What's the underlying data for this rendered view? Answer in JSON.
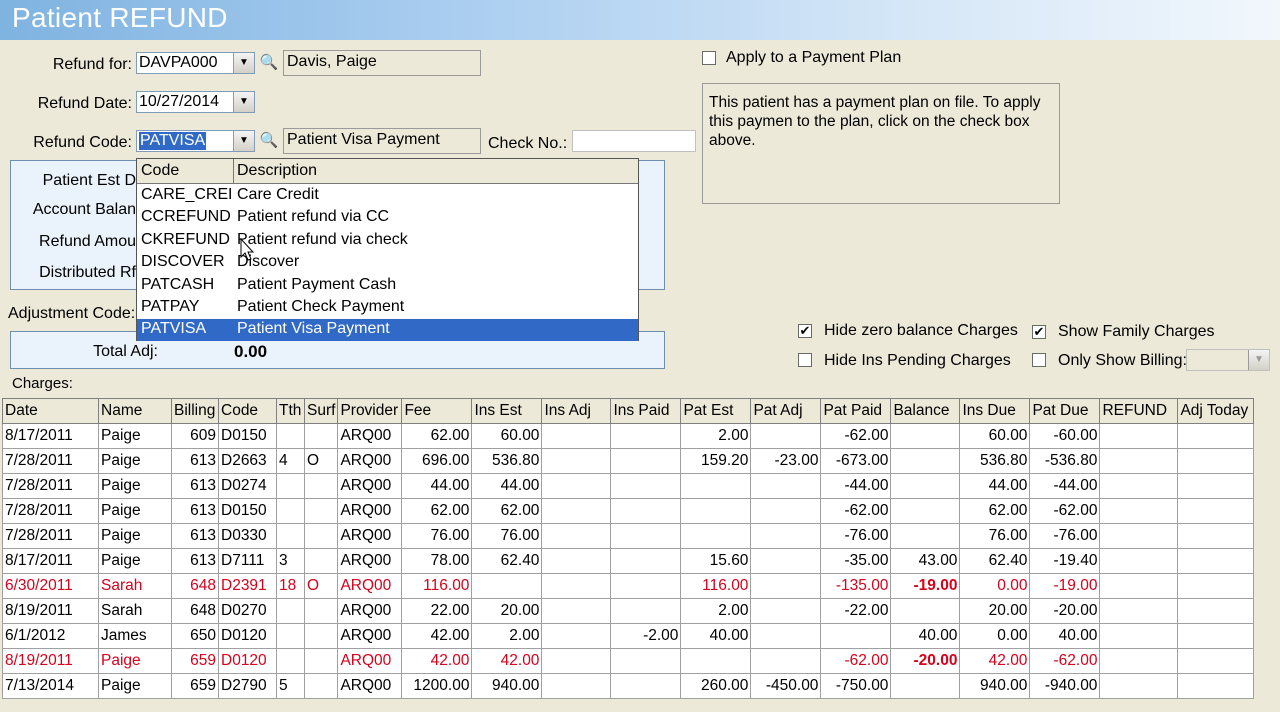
{
  "window": {
    "title": "Patient REFUND"
  },
  "form": {
    "refund_for_label": "Refund for:",
    "refund_for_value": "DAVPA000",
    "patient_name": "Davis, Paige",
    "refund_date_label": "Refund Date:",
    "refund_date_value": "10/27/2014",
    "refund_code_label": "Refund Code:",
    "refund_code_value": "PATVISA",
    "refund_code_desc": "Patient Visa Payment",
    "check_no_label": "Check No.:",
    "check_no_value": ""
  },
  "summary": {
    "patient_est_label": "Patient Est D",
    "account_balance_label": "Account Balan",
    "refund_amount_label": "Refund Amou",
    "distributed_label": "Distributed Rf"
  },
  "adjustment": {
    "code_label": "Adjustment Code:",
    "total_label": "Total Adj:",
    "total_value": "0.00"
  },
  "payment_plan": {
    "label": "Apply to a Payment Plan",
    "checked": false,
    "note": "This patient has a payment plan on file.  To apply this paymen to the plan, click on the check box above."
  },
  "filters": {
    "hide_zero": {
      "label": "Hide zero balance Charges",
      "checked": true
    },
    "show_family": {
      "label": "Show Family Charges",
      "checked": true
    },
    "hide_ins_pending": {
      "label": "Hide Ins Pending Charges",
      "checked": false
    },
    "only_billing": {
      "label": "Only Show Billing:",
      "checked": false,
      "value": ""
    }
  },
  "dropdown": {
    "headers": [
      "Code",
      "Description"
    ],
    "items": [
      {
        "code": "CARE_CREDIT",
        "desc": "Care Credit"
      },
      {
        "code": "CCREFUND",
        "desc": "Patient refund via CC"
      },
      {
        "code": "CKREFUND",
        "desc": "Patient refund via check"
      },
      {
        "code": "DISCOVER",
        "desc": "Discover"
      },
      {
        "code": "PATCASH",
        "desc": "Patient Payment Cash"
      },
      {
        "code": "PATPAY",
        "desc": "Patient Check Payment"
      },
      {
        "code": "PATVISA",
        "desc": "Patient Visa Payment"
      }
    ],
    "selected_index": 6
  },
  "charges": {
    "label": "Charges:",
    "columns": [
      "Date",
      "Name",
      "Billing",
      "Code",
      "Tth",
      "Surf",
      "Provider",
      "Fee",
      "Ins Est",
      "Ins Adj",
      "Ins Paid",
      "Pat Est",
      "Pat Adj",
      "Pat Paid",
      "Balance",
      "Ins Due",
      "Pat Due",
      "REFUND",
      "Adj Today"
    ],
    "rows": [
      {
        "red": false,
        "bold": [],
        "cells": [
          "8/17/2011",
          "Paige",
          "609",
          "D0150",
          "",
          "",
          "ARQ00",
          "62.00",
          "60.00",
          "",
          "",
          "2.00",
          "",
          "-62.00",
          "",
          "60.00",
          "-60.00",
          "",
          ""
        ]
      },
      {
        "red": false,
        "bold": [],
        "cells": [
          "7/28/2011",
          "Paige",
          "613",
          "D2663",
          "4",
          "O",
          "ARQ00",
          "696.00",
          "536.80",
          "",
          "",
          "159.20",
          "-23.00",
          "-673.00",
          "",
          "536.80",
          "-536.80",
          "",
          ""
        ]
      },
      {
        "red": false,
        "bold": [],
        "cells": [
          "7/28/2011",
          "Paige",
          "613",
          "D0274",
          "",
          "",
          "ARQ00",
          "44.00",
          "44.00",
          "",
          "",
          "",
          "",
          "-44.00",
          "",
          "44.00",
          "-44.00",
          "",
          ""
        ]
      },
      {
        "red": false,
        "bold": [],
        "cells": [
          "7/28/2011",
          "Paige",
          "613",
          "D0150",
          "",
          "",
          "ARQ00",
          "62.00",
          "62.00",
          "",
          "",
          "",
          "",
          "-62.00",
          "",
          "62.00",
          "-62.00",
          "",
          ""
        ]
      },
      {
        "red": false,
        "bold": [],
        "cells": [
          "7/28/2011",
          "Paige",
          "613",
          "D0330",
          "",
          "",
          "ARQ00",
          "76.00",
          "76.00",
          "",
          "",
          "",
          "",
          "-76.00",
          "",
          "76.00",
          "-76.00",
          "",
          ""
        ]
      },
      {
        "red": false,
        "bold": [],
        "cells": [
          "8/17/2011",
          "Paige",
          "613",
          "D7111",
          "3",
          "",
          "ARQ00",
          "78.00",
          "62.40",
          "",
          "",
          "15.60",
          "",
          "-35.00",
          "43.00",
          "62.40",
          "-19.40",
          "",
          ""
        ]
      },
      {
        "red": true,
        "bold": [
          14
        ],
        "cells": [
          "6/30/2011",
          "Sarah",
          "648",
          "D2391",
          "18",
          "O",
          "ARQ00",
          "116.00",
          "",
          "",
          "",
          "116.00",
          "",
          "-135.00",
          "-19.00",
          "0.00",
          "-19.00",
          "",
          ""
        ]
      },
      {
        "red": false,
        "bold": [],
        "cells": [
          "8/19/2011",
          "Sarah",
          "648",
          "D0270",
          "",
          "",
          "ARQ00",
          "22.00",
          "20.00",
          "",
          "",
          "2.00",
          "",
          "-22.00",
          "",
          "20.00",
          "-20.00",
          "",
          ""
        ]
      },
      {
        "red": false,
        "bold": [],
        "cells": [
          "6/1/2012",
          "James",
          "650",
          "D0120",
          "",
          "",
          "ARQ00",
          "42.00",
          "2.00",
          "",
          "-2.00",
          "40.00",
          "",
          "",
          "40.00",
          "0.00",
          "40.00",
          "",
          ""
        ]
      },
      {
        "red": true,
        "bold": [
          14
        ],
        "cells": [
          "8/19/2011",
          "Paige",
          "659",
          "D0120",
          "",
          "",
          "ARQ00",
          "42.00",
          "42.00",
          "",
          "",
          "",
          "",
          "-62.00",
          "-20.00",
          "42.00",
          "-62.00",
          "",
          ""
        ]
      },
      {
        "red": false,
        "bold": [],
        "cells": [
          "7/13/2014",
          "Paige",
          "659",
          "D2790",
          "5",
          "",
          "ARQ00",
          "1200.00",
          "940.00",
          "",
          "",
          "260.00",
          "-450.00",
          "-750.00",
          "",
          "940.00",
          "-940.00",
          "",
          ""
        ]
      }
    ]
  }
}
